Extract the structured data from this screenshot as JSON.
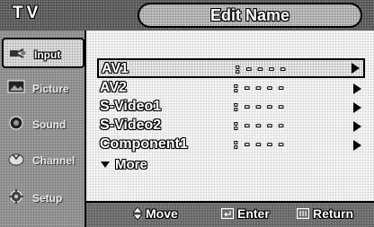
{
  "header": {
    "left_title": "TV",
    "screen_title": "Edit Name"
  },
  "sidebar": {
    "items": [
      {
        "label": "Input",
        "icon": "input-plug-icon",
        "state": "active"
      },
      {
        "label": "Picture",
        "icon": "picture-icon",
        "state": "inactive"
      },
      {
        "label": "Sound",
        "icon": "sound-icon",
        "state": "inactive"
      },
      {
        "label": "Channel",
        "icon": "channel-icon",
        "state": "inactive"
      },
      {
        "label": "Setup",
        "icon": "setup-icon",
        "state": "inactive"
      }
    ]
  },
  "list": {
    "rows": [
      {
        "label": "AV1",
        "value": ": - - - -"
      },
      {
        "label": "AV2",
        "value": ": - - - -"
      },
      {
        "label": "S-Video1",
        "value": ": - - - -"
      },
      {
        "label": "S-Video2",
        "value": ": - - - -"
      },
      {
        "label": "Component1",
        "value": ": - - - -"
      }
    ],
    "more_label": "More"
  },
  "footer": {
    "move_label": "Move",
    "enter_label": "Enter",
    "return_label": "Return"
  }
}
